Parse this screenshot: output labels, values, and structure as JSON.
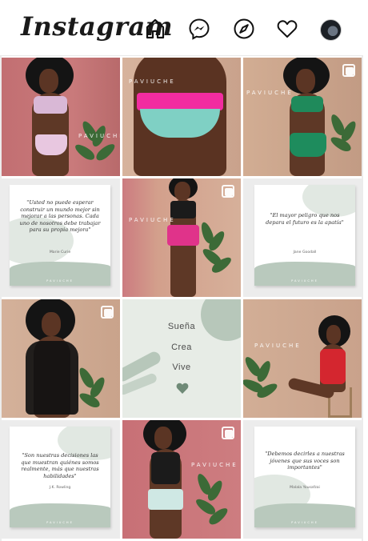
{
  "header": {
    "logo": "Instagram"
  },
  "nav": {
    "icons": [
      "home-icon",
      "messenger-icon",
      "explore-compass-icon",
      "activity-heart-icon",
      "profile-avatar"
    ]
  },
  "brand": "PAVIUCHE",
  "colors": {
    "rose_wall": "#c97376",
    "beige_wall": "#cfae94",
    "sage": "#b9c9bd",
    "heart": "#6f8a77"
  },
  "posts": [
    {
      "type": "photo"
    },
    {
      "type": "photo"
    },
    {
      "type": "photo"
    },
    {
      "type": "quote",
      "text": "\"Usted no puede esperar construir un mundo mejor sin mejorar a las personas. Cada uno de nosotros debe trabajar para su propia mejora\"",
      "author": "Marie Curie",
      "footer": "PAVIUCHE"
    },
    {
      "type": "photo"
    },
    {
      "type": "quote",
      "text": "\"El mayor peligro que nos depara el futuro es la apatía\"",
      "author": "Jane Goodall",
      "footer": "PAVIUCHE"
    },
    {
      "type": "photo"
    },
    {
      "type": "words",
      "words": [
        "Sueña",
        "Crea",
        "Vive"
      ]
    },
    {
      "type": "photo"
    },
    {
      "type": "quote",
      "text": "\"Son nuestras decisiones las que muestran quiénes somos realmente, más que nuestras habilidades\"",
      "author": "J.K. Rowling",
      "footer": "PAVIUCHE"
    },
    {
      "type": "photo"
    },
    {
      "type": "quote",
      "text": "\"Debemos decirles a nuestras jóvenes que sus voces son importantes\"",
      "author": "Malala Yousafzai",
      "footer": "PAVIUCHE"
    }
  ]
}
